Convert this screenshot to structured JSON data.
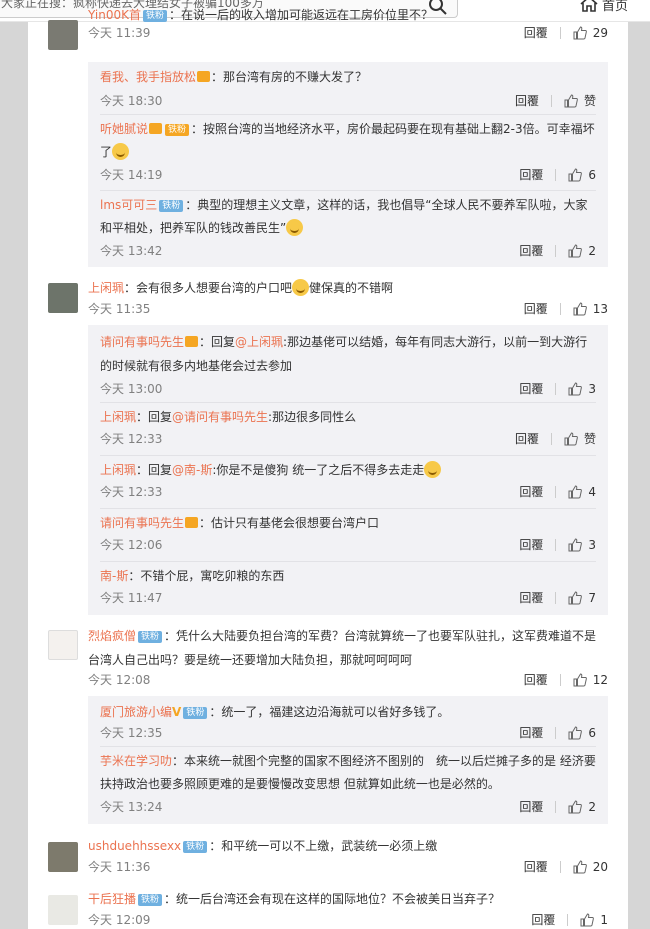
{
  "topbar": {
    "search_text": "大家正在搜：疯称快递去大理结女子被骗100多万",
    "home_label": "首页"
  },
  "action_labels": {
    "reply": "回覆"
  },
  "comments": [
    {
      "name": "Yin00K首",
      "badge": "铁粉",
      "text": "：在说一后的收入增加可能返远在工房价位里不？",
      "time": "今天 11:39",
      "likes": "29",
      "replies": [
        {
          "name": "看我、我手指放松",
          "text": "：那台湾有房的不赚大发了？",
          "time": "今天 18:30",
          "likes": "赞"
        },
        {
          "name": "听她腻说",
          "badge": "铁粉",
          "text": "：按照台湾的当地经济水平，房价最起码要在现有基础上翻2-3倍。可幸福坏了",
          "time": "今天 14:19",
          "likes": "6"
        },
        {
          "name": "lms可可三",
          "badge": "铁粉",
          "text": "：典型的理想主义文章，这样的话，我也倡导“全球人民不要养军队啦，大家和平相处，把养军队的钱改善民生”",
          "time": "今天 13:42",
          "likes": "2"
        }
      ]
    },
    {
      "name": "上闲珮",
      "text": "：会有很多人想要台湾的户口吧",
      "text_after": "健保真的不错啊",
      "time": "今天 11:35",
      "likes": "13",
      "replies": [
        {
          "name": "请问有事吗先生",
          "text_pre": "：回复",
          "at": "@上闲珮",
          "text": ":那边基佬可以结婚，每年有同志大游行，以前一到大游行的时候就有很多内地基佬会过去参加",
          "time": "今天 13:00",
          "likes": "3"
        },
        {
          "name": "上闲珮",
          "text_pre": "：回复",
          "at": "@请问有事吗先生",
          "text": ":那边很多同性么",
          "time": "今天 12:33",
          "likes": "赞"
        },
        {
          "name": "上闲珮",
          "text_pre": "：回复",
          "at": "@南-斯",
          "text": ":你是不是傻狗 统一了之后不得多去走走",
          "time": "今天 12:33",
          "likes": "4"
        },
        {
          "name": "请问有事吗先生",
          "text": "：估计只有基佬会很想要台湾户口",
          "time": "今天 12:06",
          "likes": "3"
        },
        {
          "name": "南-斯",
          "text": "：不错个屁，寓吃卯粮的东西",
          "time": "今天 11:47",
          "likes": "7"
        }
      ]
    },
    {
      "name": "烈焰疯僧",
      "badge": "铁粉",
      "text": "：凭什么大陆要负担台湾的军费？台湾就算统一了也要军队驻扎，这军费难道不是台湾人自己出吗？要是统一还要增加大陆负担，那就呵呵呵呵",
      "time": "今天 12:08",
      "likes": "12",
      "replies": [
        {
          "name": "厦门旅游小编",
          "badge": "铁粉",
          "text": "：统一了，福建这边沿海就可以省好多钱了。",
          "time": "今天 12:35",
          "likes": "6"
        },
        {
          "name": "芋米在学习叻",
          "text": "：本来统一就图个完整的国家不图经济不图别的　统一以后烂摊子多的是 经济要扶持政治也要多照顾更难的是要慢慢改变思想 但就算如此统一也是必然的。",
          "time": "今天 13:24",
          "likes": "2"
        }
      ]
    },
    {
      "name": "ushduehhssexx",
      "badge": "铁粉",
      "text": "：和平统一可以不上缴，武装统一必须上缴",
      "time": "今天 11:36",
      "likes": "20"
    },
    {
      "name": "干后狂播",
      "badge": "铁粉",
      "text": "：统一后台湾还会有现在这样的国际地位？不会被美日当弃子？",
      "time": "今天 12:09",
      "likes": "1"
    }
  ]
}
